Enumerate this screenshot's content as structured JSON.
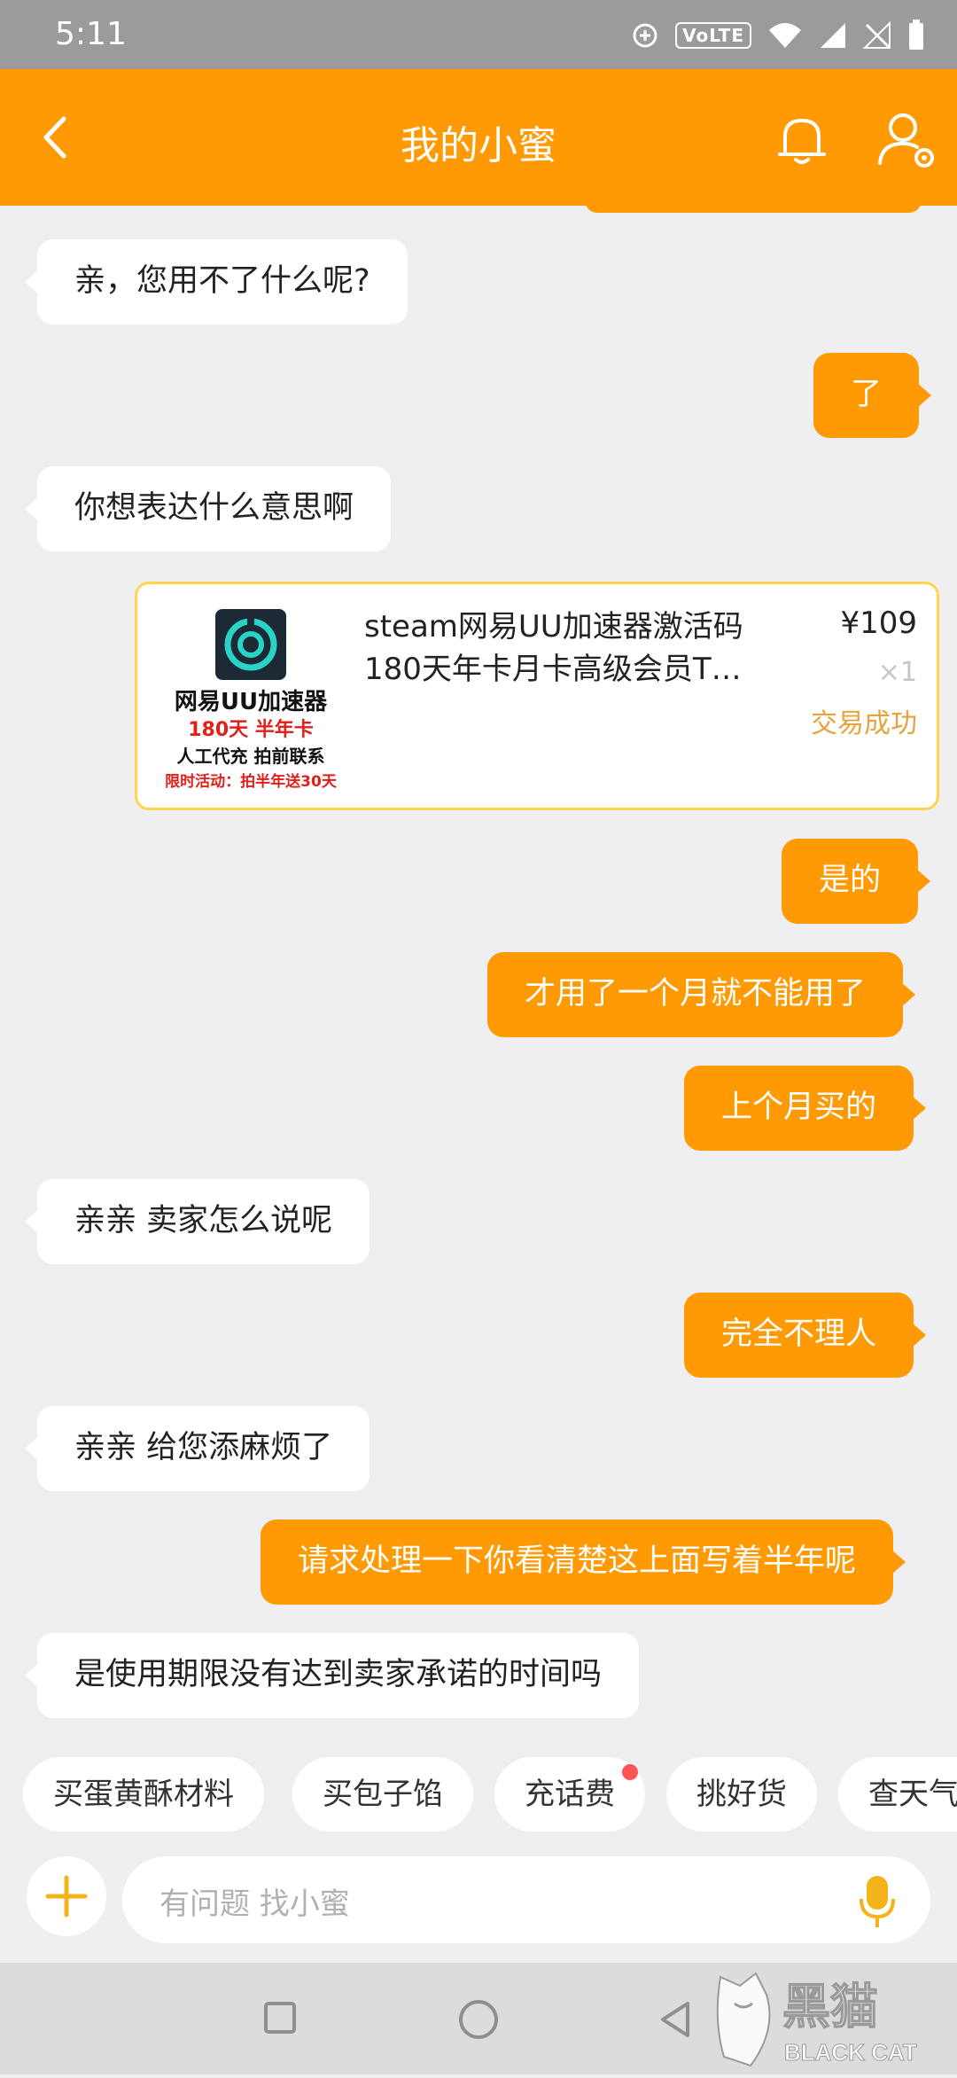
{
  "status_bar": {
    "time": "5:11",
    "volte_label": "VoLTE"
  },
  "header": {
    "title": "我的小蜜"
  },
  "messages": [
    {
      "from": "bot",
      "text": "亲，您用不了什么呢?"
    },
    {
      "from": "user",
      "text": "了"
    },
    {
      "from": "bot",
      "text": "你想表达什么意思啊"
    },
    {
      "from": "user",
      "text": "是的"
    },
    {
      "from": "user",
      "text": "才用了一个月就不能用了"
    },
    {
      "from": "user",
      "text": "上个月买的"
    },
    {
      "from": "bot",
      "text": "亲亲 卖家怎么说呢"
    },
    {
      "from": "user",
      "text": "完全不理人"
    },
    {
      "from": "bot",
      "text": "亲亲 给您添麻烦了"
    },
    {
      "from": "user",
      "text": "请求处理一下你看清楚这上面写着半年呢"
    },
    {
      "from": "bot",
      "text": "是使用期限没有达到卖家承诺的时间吗"
    }
  ],
  "order_card": {
    "product_name_line1": "steam网易UU加速器激活码",
    "product_name_line2": "180天年卡月卡高级会员T…",
    "price": "¥109",
    "quantity": "×1",
    "status": "交易成功",
    "thumbnail": {
      "line1": "网易UU加速器",
      "line2": "180天 半年卡",
      "line3": "人工代充 拍前联系",
      "line4": "限时活动：拍半年送30天"
    }
  },
  "quick_chips": [
    {
      "label": "买蛋黄酥材料",
      "badge": false
    },
    {
      "label": "买包子馅",
      "badge": false
    },
    {
      "label": "充话费",
      "badge": true
    },
    {
      "label": "挑好货",
      "badge": false
    },
    {
      "label": "查天气",
      "badge": false
    }
  ],
  "input": {
    "placeholder": "有问题 找小蜜"
  },
  "watermark": {
    "text_cn": "黑猫",
    "text_en": "BLACK CAT"
  },
  "colors": {
    "accent": "#ff9a05",
    "background": "#efeff2",
    "card_border": "#ffd54f",
    "status_text": "#e8a43a"
  }
}
